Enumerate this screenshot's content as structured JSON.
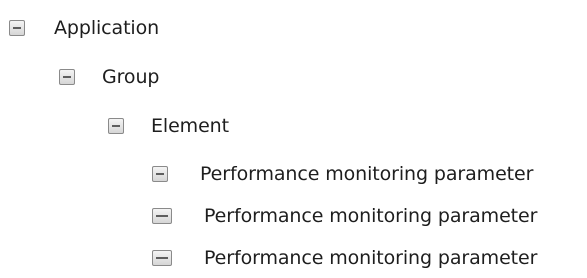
{
  "tree": {
    "application": {
      "label": "Application",
      "icon": "collapse-icon"
    },
    "group": {
      "label": "Group",
      "icon": "collapse-icon"
    },
    "element": {
      "label": "Element",
      "icon": "collapse-icon"
    },
    "parameters": [
      {
        "label": "Performance monitoring parameter",
        "icon": "collapse-icon"
      },
      {
        "label": "Performance monitoring parameter",
        "icon": "collapse-icon"
      },
      {
        "label": "Performance monitoring parameter",
        "icon": "collapse-icon"
      }
    ]
  }
}
